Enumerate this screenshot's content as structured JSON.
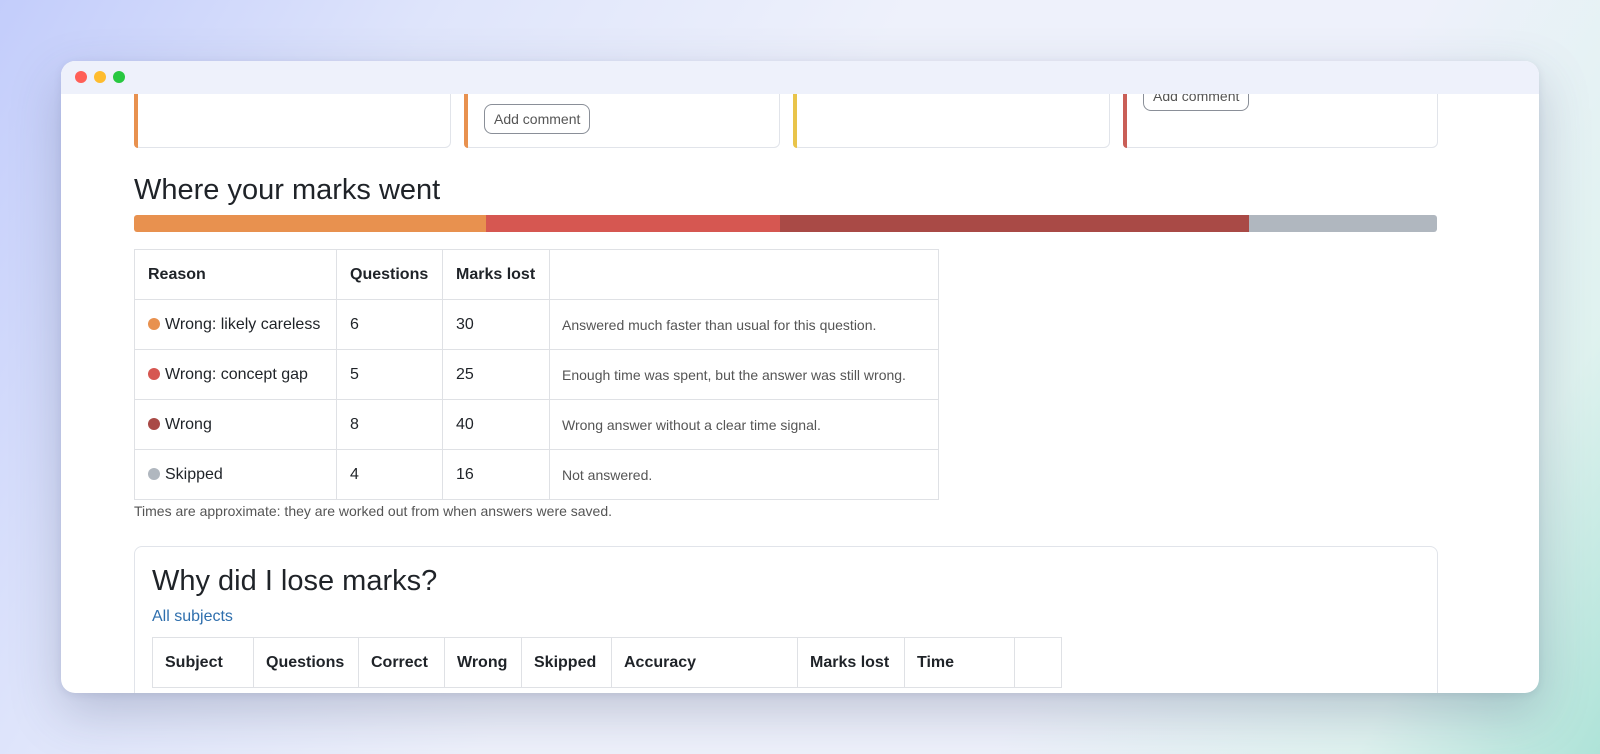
{
  "top_cards": [
    {
      "accent": "#e8914f",
      "button": ""
    },
    {
      "accent": "#e8914f",
      "button": "Add comment"
    },
    {
      "accent": "#e9c44a",
      "button": ""
    },
    {
      "accent": "#c95e57",
      "button": "Add comment"
    }
  ],
  "breakdown": {
    "title": "Where your marks went",
    "segments": [
      {
        "reason": "Wrong: likely careless",
        "marks": 30,
        "color": "#e8914f"
      },
      {
        "reason": "Wrong: concept gap",
        "marks": 25,
        "color": "#d65751"
      },
      {
        "reason": "Wrong",
        "marks": 40,
        "color": "#a94a46"
      },
      {
        "reason": "Skipped",
        "marks": 16,
        "color": "#b0b7bf"
      }
    ],
    "table": {
      "headers": [
        "Reason",
        "Questions",
        "Marks lost",
        ""
      ],
      "rows": [
        {
          "reason": "Wrong: likely careless",
          "questions": "6",
          "marks_lost": "30",
          "note": "Answered much faster than usual for this question.",
          "color": "#e8914f"
        },
        {
          "reason": "Wrong: concept gap",
          "questions": "5",
          "marks_lost": "25",
          "note": "Enough time was spent, but the answer was still wrong.",
          "color": "#d65751"
        },
        {
          "reason": "Wrong",
          "questions": "8",
          "marks_lost": "40",
          "note": "Wrong answer without a clear time signal.",
          "color": "#a94a46"
        },
        {
          "reason": "Skipped",
          "questions": "4",
          "marks_lost": "16",
          "note": "Not answered.",
          "color": "#b0b7bf"
        }
      ]
    },
    "footnote": "Times are approximate: they are worked out from when answers were saved."
  },
  "lose_marks": {
    "title": "Why did I lose marks?",
    "filter_link": "All subjects",
    "headers": [
      "Subject",
      "Questions",
      "Correct",
      "Wrong",
      "Skipped",
      "Accuracy",
      "Marks lost",
      "Time",
      ""
    ]
  }
}
